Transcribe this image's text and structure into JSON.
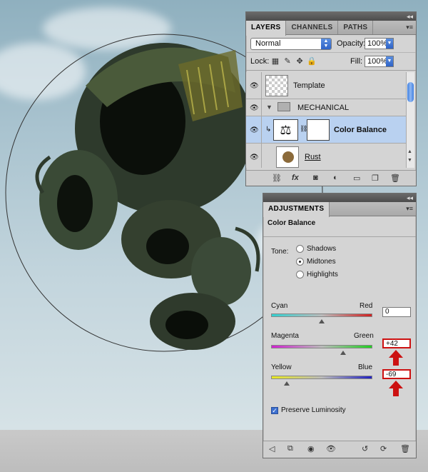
{
  "layers_panel": {
    "tabs": [
      "LAYERS",
      "CHANNELS",
      "PATHS"
    ],
    "blend_mode": "Normal",
    "opacity_label": "Opacity:",
    "opacity_value": "100%",
    "lock_label": "Lock:",
    "fill_label": "Fill:",
    "fill_value": "100%",
    "layers": [
      {
        "name": "Template",
        "type": "layer"
      },
      {
        "name": "MECHANICAL",
        "type": "group"
      },
      {
        "name": "Color Balance",
        "type": "adjustment",
        "selected": true
      },
      {
        "name": "Rust",
        "type": "layer"
      }
    ]
  },
  "adjustments_panel": {
    "tab": "ADJUSTMENTS",
    "title": "Color Balance",
    "tone_label": "Tone:",
    "tones": [
      "Shadows",
      "Midtones",
      "Highlights"
    ],
    "selected_tone": "Midtones",
    "sliders": [
      {
        "left": "Cyan",
        "right": "Red",
        "value": "0",
        "level": 0,
        "left_color": "#33d0d0",
        "right_color": "#d02020"
      },
      {
        "left": "Magenta",
        "right": "Green",
        "value": "+42",
        "level": 42,
        "left_color": "#d020d0",
        "right_color": "#20d020"
      },
      {
        "left": "Yellow",
        "right": "Blue",
        "value": "-69",
        "level": -69,
        "left_color": "#e8e820",
        "right_color": "#2020c0"
      }
    ],
    "preserve_luminosity": "Preserve Luminosity",
    "preserve_checked": true
  },
  "colors": {
    "selection": "#b9d1f0",
    "annotation_arrow": "#cc1111"
  }
}
